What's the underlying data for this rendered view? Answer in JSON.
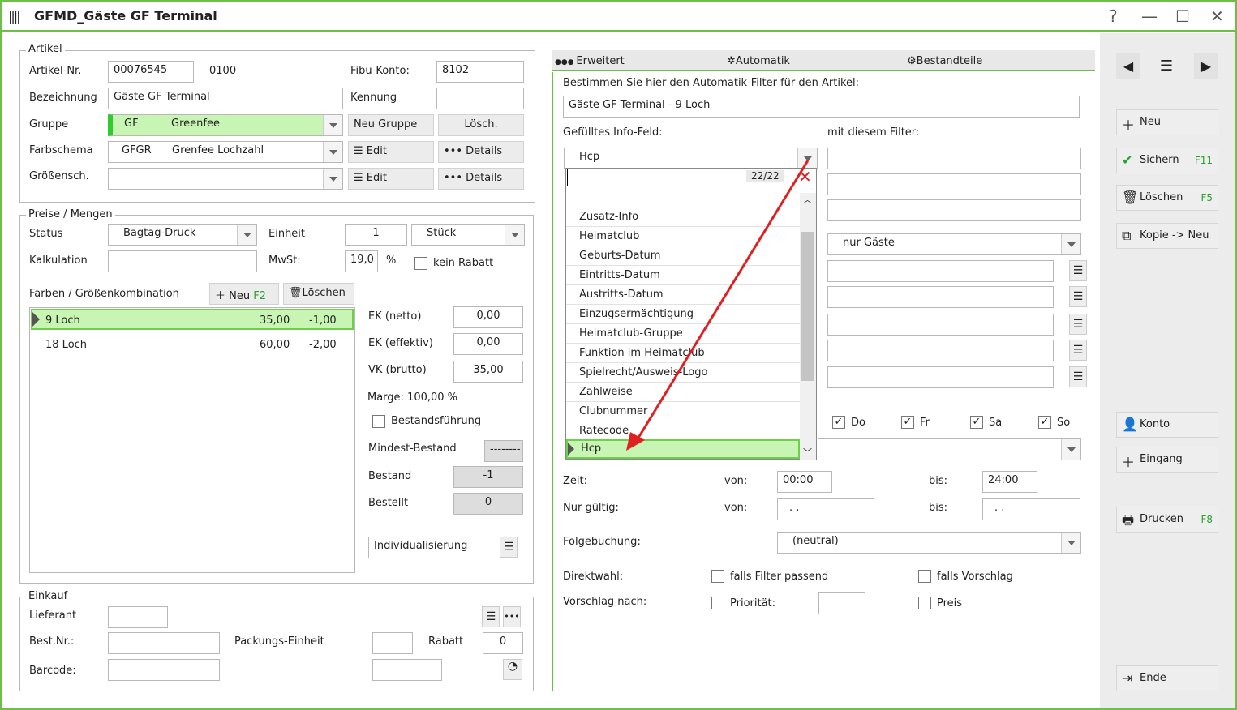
{
  "window": {
    "title": "GFMD_Gäste GF Terminal"
  },
  "artikel": {
    "title": "Artikel",
    "nr_label": "Artikel-Nr.",
    "nr": "00076545",
    "nr_suffix": "0100",
    "fibu_label": "Fibu-Konto:",
    "fibu": "8102",
    "bez_label": "Bezeichnung",
    "bez": "Gäste GF Terminal",
    "kennung_label": "Kennung",
    "gruppe_label": "Gruppe",
    "gruppe_code": "GF",
    "gruppe_name": "Greenfee",
    "neu_gruppe": "Neu Gruppe",
    "losch": "Lösch.",
    "farb_label": "Farbschema",
    "farb_code": "GFGR",
    "farb_name": "Grenfee Lochzahl",
    "edit": "Edit",
    "details": "Details",
    "groessen_label": "Größensch."
  },
  "preise": {
    "title": "Preise / Mengen",
    "status_label": "Status",
    "status": "Bagtag-Druck",
    "einheit_label": "Einheit",
    "einheit_val": "1",
    "einheit_unit": "Stück",
    "kalk_label": "Kalkulation",
    "mwst_label": "MwSt:",
    "mwst": "19,0",
    "pct": "%",
    "kein_rabatt": "kein Rabatt",
    "fg_label": "Farben / Größenkombination",
    "neu": "Neu",
    "neu_key": "F2",
    "loeschen": "Löschen",
    "rows": [
      {
        "name": "9 Loch",
        "a": "35,00",
        "b": "-1,00"
      },
      {
        "name": "18 Loch",
        "a": "60,00",
        "b": "-2,00"
      }
    ],
    "ek_netto_label": "EK (netto)",
    "ek_netto": "0,00",
    "ek_eff_label": "EK (effektiv)",
    "ek_eff": "0,00",
    "vk_label": "VK (brutto)",
    "vk": "35,00",
    "marge": "Marge: 100,00 %",
    "bestandsf": "Bestandsführung",
    "mindest_label": "Mindest-Bestand",
    "mindest": "--------",
    "bestand_label": "Bestand",
    "bestand": "-1",
    "bestellt_label": "Bestellt",
    "bestellt": "0",
    "indiv": "Individualisierung"
  },
  "einkauf": {
    "title": "Einkauf",
    "lieferant": "Lieferant",
    "bestnr": "Best.Nr.:",
    "packung": "Packungs-Einheit",
    "rabatt": "Rabatt",
    "rabatt_val": "0",
    "barcode": "Barcode:"
  },
  "tabs": [
    {
      "label": "Erweitert"
    },
    {
      "label": "Automatik"
    },
    {
      "label": "Bestandteile"
    }
  ],
  "auto": {
    "intro": "Bestimmen Sie hier den Automatik-Filter für den Artikel:",
    "filter_name": "Gäste GF Terminal - 9 Loch",
    "info_label": "Gefülltes Info-Feld:",
    "mit_label": "mit diesem Filter:",
    "info_value": "Hcp",
    "nur_gaeste": "nur Gäste",
    "days": [
      "Do",
      "Fr",
      "Sa",
      "So"
    ],
    "zeit": "Zeit:",
    "von": "von:",
    "bis": "bis:",
    "zeit_von": "00:00",
    "zeit_bis": "24:00",
    "nur_gueltig": "Nur gültig:",
    "date_von": ". .",
    "date_bis": ". .",
    "folge_label": "Folgebuchung:",
    "folge": "(neutral)",
    "direkt_label": "Direktwahl:",
    "falls_filter": "falls Filter passend",
    "falls_vorschlag": "falls Vorschlag",
    "vorschlag_label": "Vorschlag nach:",
    "prioritaet": "Priorität:",
    "preis": "Preis"
  },
  "dropdown": {
    "count": "22/22",
    "items": [
      "Zusatz-Info",
      "Heimatclub",
      "Geburts-Datum",
      "Eintritts-Datum",
      "Austritts-Datum",
      "Einzugsermächtigung",
      "Heimatclub-Gruppe",
      "Funktion im Heimatclub",
      "Spielrecht/Ausweis-Logo",
      "Zahlweise",
      "Clubnummer",
      "Ratecode",
      "Hcp"
    ]
  },
  "sidebar": {
    "neu": "Neu",
    "sichern": "Sichern",
    "sichern_key": "F11",
    "loeschen": "Löschen",
    "loeschen_key": "F5",
    "kopie": "Kopie -> Neu",
    "konto": "Konto",
    "eingang": "Eingang",
    "drucken": "Drucken",
    "drucken_key": "F8",
    "ende": "Ende"
  },
  "colors": {
    "accent": "#6cbf47",
    "selected": "#c8f5b4",
    "arrow": "#e02020"
  }
}
